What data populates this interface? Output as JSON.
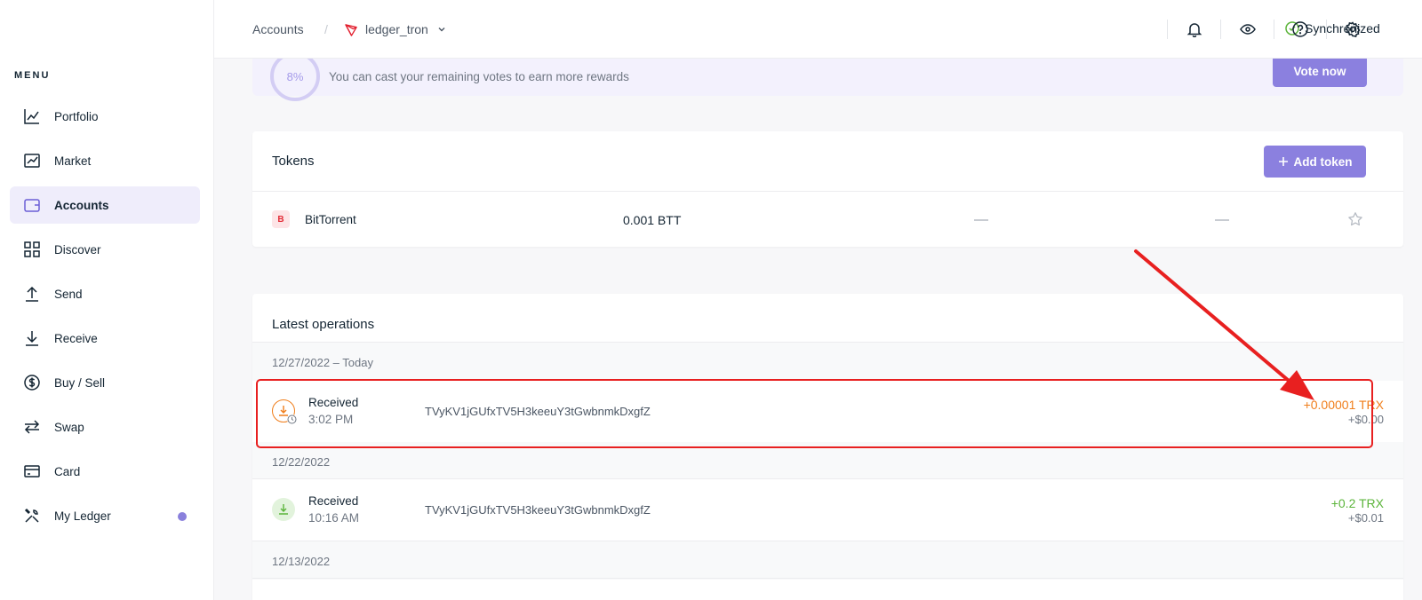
{
  "sidebar": {
    "menu_title": "MENU",
    "items": [
      {
        "label": "Portfolio",
        "icon": "chart-line-icon"
      },
      {
        "label": "Market",
        "icon": "trend-icon"
      },
      {
        "label": "Accounts",
        "icon": "wallet-icon",
        "active": true
      },
      {
        "label": "Discover",
        "icon": "grid-icon"
      },
      {
        "label": "Send",
        "icon": "arrow-up-icon"
      },
      {
        "label": "Receive",
        "icon": "arrow-down-icon"
      },
      {
        "label": "Buy / Sell",
        "icon": "dollar-icon"
      },
      {
        "label": "Swap",
        "icon": "swap-icon"
      },
      {
        "label": "Card",
        "icon": "card-icon"
      },
      {
        "label": "My Ledger",
        "icon": "tools-icon",
        "badge_dot": true
      }
    ]
  },
  "topbar": {
    "breadcrumb_root": "Accounts",
    "breadcrumb_sep": "/",
    "account_name": "ledger_tron",
    "sync_status": "Synchronized"
  },
  "vote": {
    "percent": "8%",
    "text": "You can cast your remaining votes to earn more rewards",
    "button": "Vote now"
  },
  "tokens": {
    "title": "Tokens",
    "add_button": "Add token",
    "rows": [
      {
        "badge": "B",
        "name": "BitTorrent",
        "amount": "0.001 BTT"
      }
    ]
  },
  "operations": {
    "title": "Latest operations",
    "groups": [
      {
        "date": "12/27/2022 – Today",
        "ops": [
          {
            "type": "Received",
            "time": "3:02 PM",
            "address": "TVyKV1jGUfxTV5H3keeuY3tGwbnmkDxgfZ",
            "amount": "+0.00001 TRX",
            "fiat": "+$0.00",
            "status": "pending"
          }
        ]
      },
      {
        "date": "12/22/2022",
        "ops": [
          {
            "type": "Received",
            "time": "10:16 AM",
            "address": "TVyKV1jGUfxTV5H3keeuY3tGwbnmkDxgfZ",
            "amount": "+0.2 TRX",
            "fiat": "+$0.01",
            "status": "confirmed"
          }
        ]
      },
      {
        "date": "12/13/2022",
        "ops": []
      }
    ]
  },
  "colors": {
    "accent": "#8b80df",
    "pending": "#f07e1b",
    "confirmed": "#5bb43a",
    "annotation": "#e82020"
  }
}
